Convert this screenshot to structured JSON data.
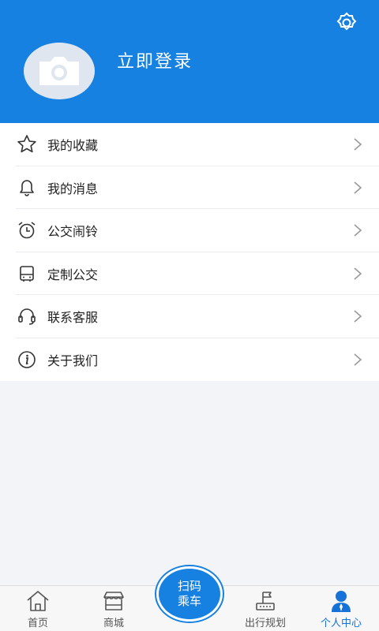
{
  "header": {
    "login_text": "立即登录"
  },
  "menu": {
    "items": [
      {
        "label": "我的收藏",
        "icon": "star-icon"
      },
      {
        "label": "我的消息",
        "icon": "bell-icon"
      },
      {
        "label": "公交闹铃",
        "icon": "alarm-clock-icon"
      },
      {
        "label": "定制公交",
        "icon": "bus-icon"
      },
      {
        "label": "联系客服",
        "icon": "headset-icon"
      },
      {
        "label": "关于我们",
        "icon": "info-icon"
      }
    ]
  },
  "tabbar": {
    "home": "首页",
    "mall": "商城",
    "scan_line1": "扫码",
    "scan_line2": "乘车",
    "trip": "出行规划",
    "profile": "个人中心"
  },
  "colors": {
    "primary": "#1681e1",
    "active_tab": "#1672d8"
  }
}
